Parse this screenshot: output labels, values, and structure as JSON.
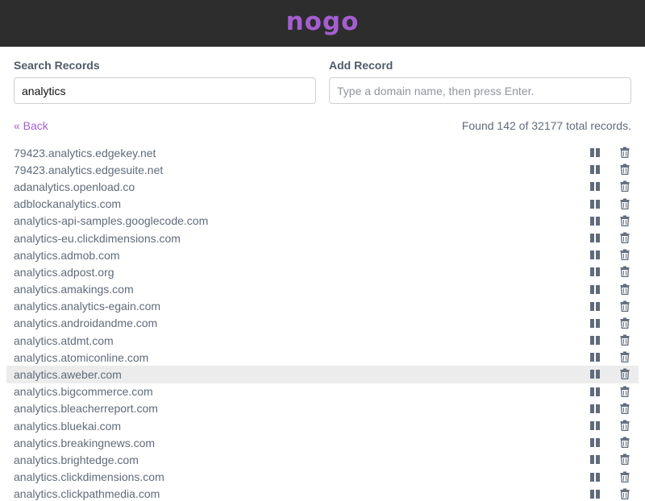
{
  "app": {
    "brand": "nogo"
  },
  "search": {
    "label": "Search Records",
    "value": "analytics",
    "placeholder": ""
  },
  "add": {
    "label": "Add Record",
    "value": "",
    "placeholder": "Type a domain name, then press Enter."
  },
  "status": {
    "back_label": "« Back",
    "found_text": "Found 142 of 32177 total records."
  },
  "records": [
    {
      "domain": "79423.analytics.edgekey.net"
    },
    {
      "domain": "79423.analytics.edgesuite.net"
    },
    {
      "domain": "adanalytics.openload.co"
    },
    {
      "domain": "adblockanalytics.com"
    },
    {
      "domain": "analytics-api-samples.googlecode.com"
    },
    {
      "domain": "analytics-eu.clickdimensions.com"
    },
    {
      "domain": "analytics.admob.com"
    },
    {
      "domain": "analytics.adpost.org"
    },
    {
      "domain": "analytics.amakings.com"
    },
    {
      "domain": "analytics.analytics-egain.com"
    },
    {
      "domain": "analytics.androidandme.com"
    },
    {
      "domain": "analytics.atdmt.com"
    },
    {
      "domain": "analytics.atomiconline.com"
    },
    {
      "domain": "analytics.aweber.com",
      "highlighted": true
    },
    {
      "domain": "analytics.bigcommerce.com"
    },
    {
      "domain": "analytics.bleacherreport.com"
    },
    {
      "domain": "analytics.bluekai.com"
    },
    {
      "domain": "analytics.breakingnews.com"
    },
    {
      "domain": "analytics.brightedge.com"
    },
    {
      "domain": "analytics.clickdimensions.com"
    },
    {
      "domain": "analytics.clickpathmedia.com"
    }
  ],
  "icons": {
    "row_pause": "pause-icon",
    "row_delete": "trash-icon"
  },
  "colors": {
    "brand": "#a55ed1",
    "header_bg": "#2d2d2d",
    "text": "#5f6b7a",
    "highlight_bg": "#ececec"
  }
}
